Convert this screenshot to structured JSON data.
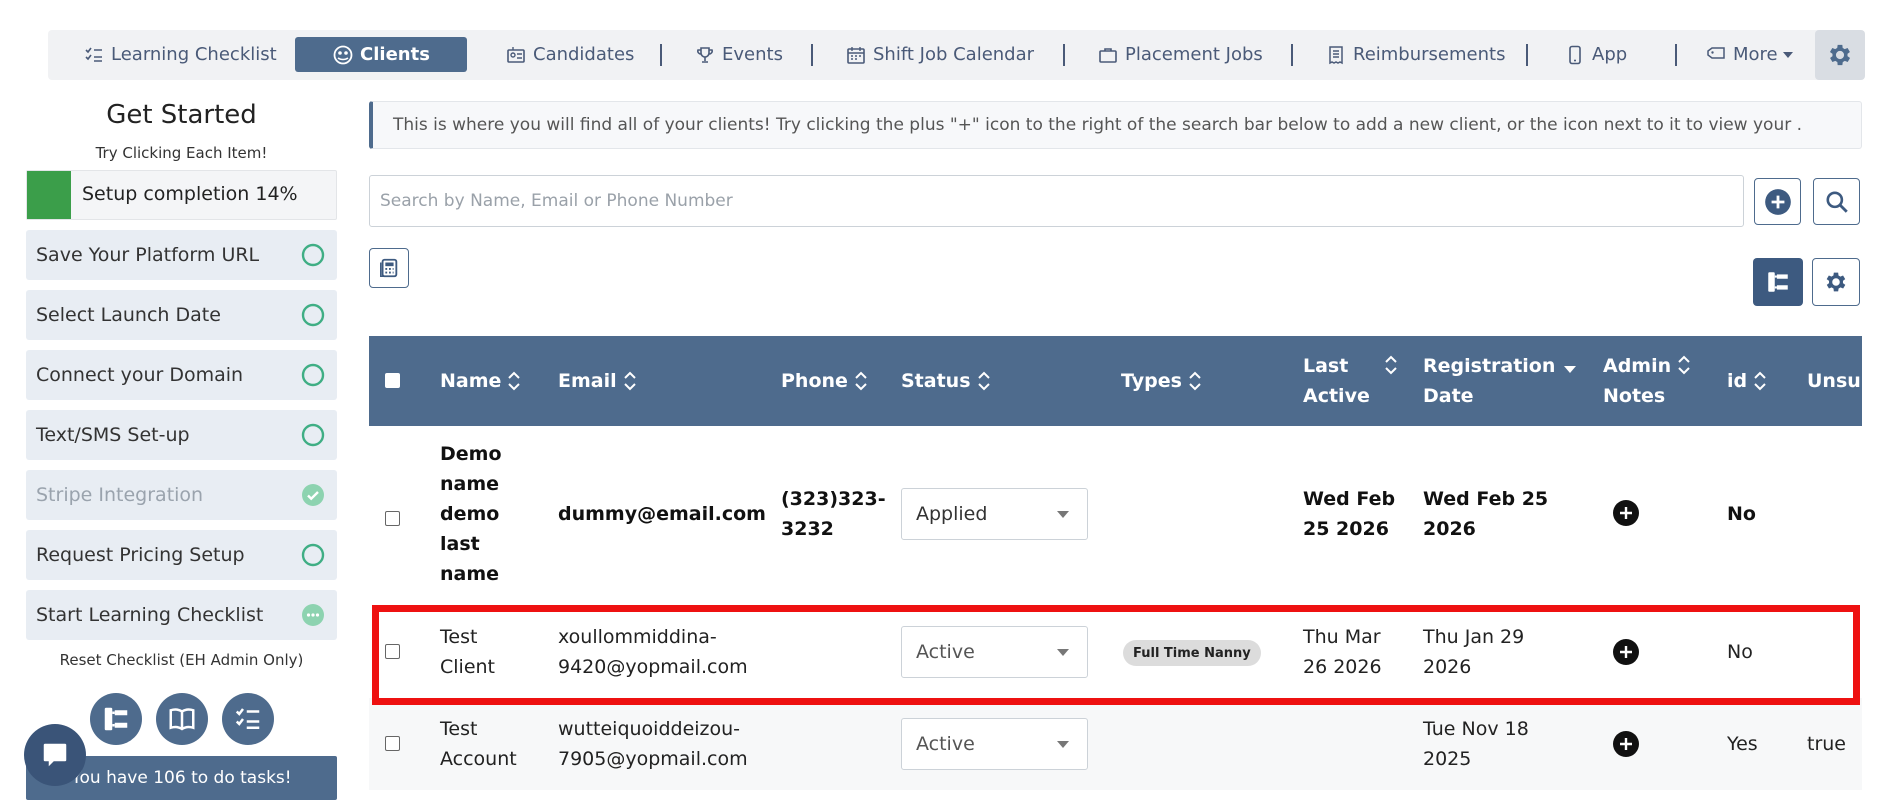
{
  "nav": {
    "items": [
      {
        "label": "Learning Checklist",
        "icon": "checklist-icon"
      },
      {
        "label": "Clients",
        "icon": "clients-icon",
        "active": true
      },
      {
        "label": "Candidates",
        "icon": "candidates-icon"
      },
      {
        "label": "Events",
        "icon": "trophy-icon"
      },
      {
        "label": "Shift Job Calendar",
        "icon": "calendar-icon"
      },
      {
        "label": "Placement Jobs",
        "icon": "briefcase-icon"
      },
      {
        "label": "Reimbursements",
        "icon": "receipt-icon"
      },
      {
        "label": "App",
        "icon": "phone-icon"
      },
      {
        "label": "More",
        "icon": "tag-icon"
      }
    ],
    "settings_icon": "gear-icon"
  },
  "sidebar": {
    "title": "Get Started",
    "subtitle": "Try Clicking Each Item!",
    "progress_label": "Setup completion 14%",
    "progress_fraction": 0.14,
    "tasks": [
      {
        "label": "Save Your Platform URL",
        "state": "pending"
      },
      {
        "label": "Select Launch Date",
        "state": "pending"
      },
      {
        "label": "Connect your Domain",
        "state": "pending"
      },
      {
        "label": "Text/SMS Set-up",
        "state": "pending"
      },
      {
        "label": "Stripe Integration",
        "state": "done"
      },
      {
        "label": "Request Pricing Setup",
        "state": "pending"
      },
      {
        "label": "Start Learning Checklist",
        "state": "in-progress"
      }
    ],
    "reset_label": "Reset Checklist (EH Admin Only)",
    "quick_icons": [
      "org-chart-icon",
      "book-icon",
      "checklist-icon"
    ],
    "todo_label": "You have 106 to do tasks!"
  },
  "main": {
    "info_text": "This is where you will find all of your clients! Try clicking the plus \"+\" icon to the right of the search bar below to add a new client, or the icon next to it to view your .",
    "search": {
      "placeholder": "Search by Name, Email or Phone Number",
      "value": ""
    }
  },
  "table": {
    "headers": {
      "name": "Name",
      "email": "Email",
      "phone": "Phone",
      "status": "Status",
      "types": "Types",
      "last_active_1": "Last",
      "last_active_2": "Active",
      "registration_1": "Registration",
      "registration_2": "Date",
      "admin_notes_1": "Admin",
      "admin_notes_2": "Notes",
      "id": "id",
      "unsubscribed": "Unsubs"
    },
    "rows": [
      {
        "name_lines": [
          "Demo",
          "name",
          "demo",
          "last",
          "name"
        ],
        "email": "dummy@email.com",
        "phone_lines": [
          "(323)323-",
          "3232"
        ],
        "status": "Applied",
        "types": "",
        "last_active_lines": [
          "Wed Feb",
          "25 2026"
        ],
        "registration_lines": [
          "Wed Feb 25",
          "2026"
        ],
        "id": "No",
        "unsubscribed": ""
      },
      {
        "name_lines": [
          "Test",
          "Client"
        ],
        "email_lines": [
          "xoullommiddina-",
          "9420@yopmail.com"
        ],
        "phone_lines": [],
        "status": "Active",
        "types": "Full Time Nanny",
        "last_active_lines": [
          "Thu Mar",
          "26 2026"
        ],
        "registration_lines": [
          "Thu Jan 29",
          "2026"
        ],
        "id": "No",
        "unsubscribed": ""
      },
      {
        "name_lines": [
          "Test",
          "Account"
        ],
        "email_lines": [
          "wutteiquoiddeizou-",
          "7905@yopmail.com"
        ],
        "phone_lines": [],
        "status": "Active",
        "types": "",
        "last_active_lines": [],
        "registration_lines": [
          "Tue Nov 18",
          "2025"
        ],
        "id": "Yes",
        "unsubscribed": "true"
      }
    ]
  },
  "colors": {
    "primary": "#4e6b8d",
    "progress": "#3b9e4a",
    "highlight": "#ee1111",
    "task_bg": "#e8edf3"
  }
}
